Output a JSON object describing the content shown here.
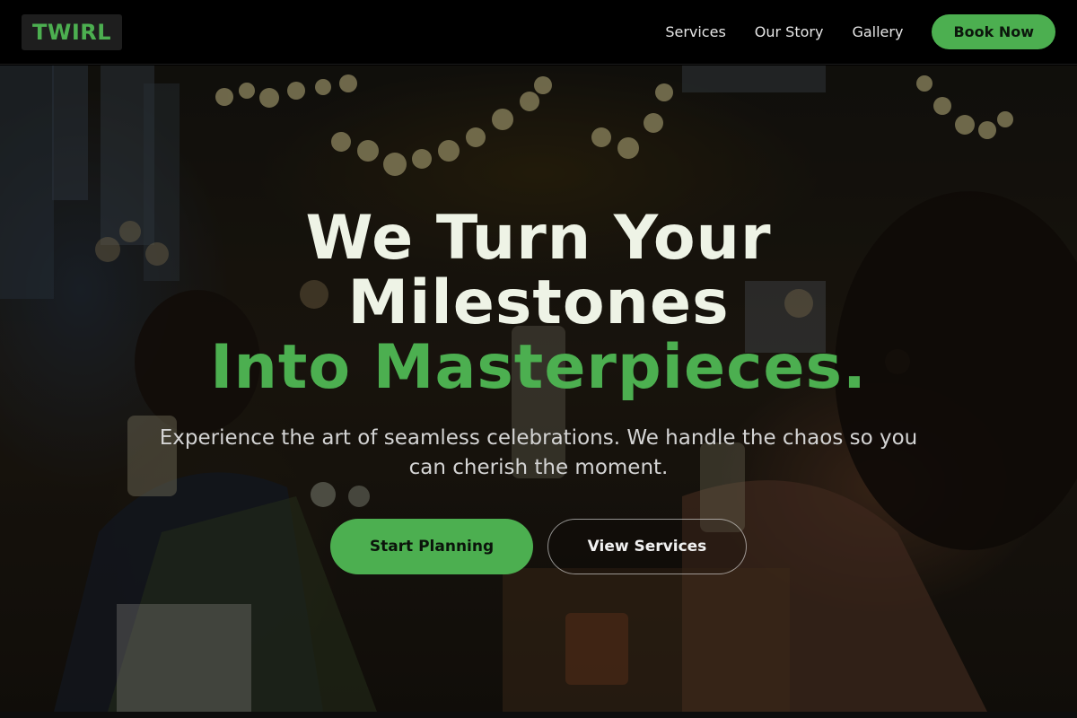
{
  "header": {
    "logo": "TWIRL",
    "nav": [
      "Services",
      "Our Story",
      "Gallery"
    ],
    "book_label": "Book Now"
  },
  "hero": {
    "headline_line1": "We Turn Your",
    "headline_line2": "Milestones",
    "headline_accent": "Into Masterpieces.",
    "subtitle": "Experience the art of seamless celebrations. We handle the chaos so you can cherish the moment.",
    "primary_cta": "Start Planning",
    "secondary_cta": "View Services",
    "background_icon": "party-toast-photo"
  },
  "colors": {
    "accent": "#4caf50",
    "header_bg": "#000000",
    "headline": "#eef3e6"
  }
}
